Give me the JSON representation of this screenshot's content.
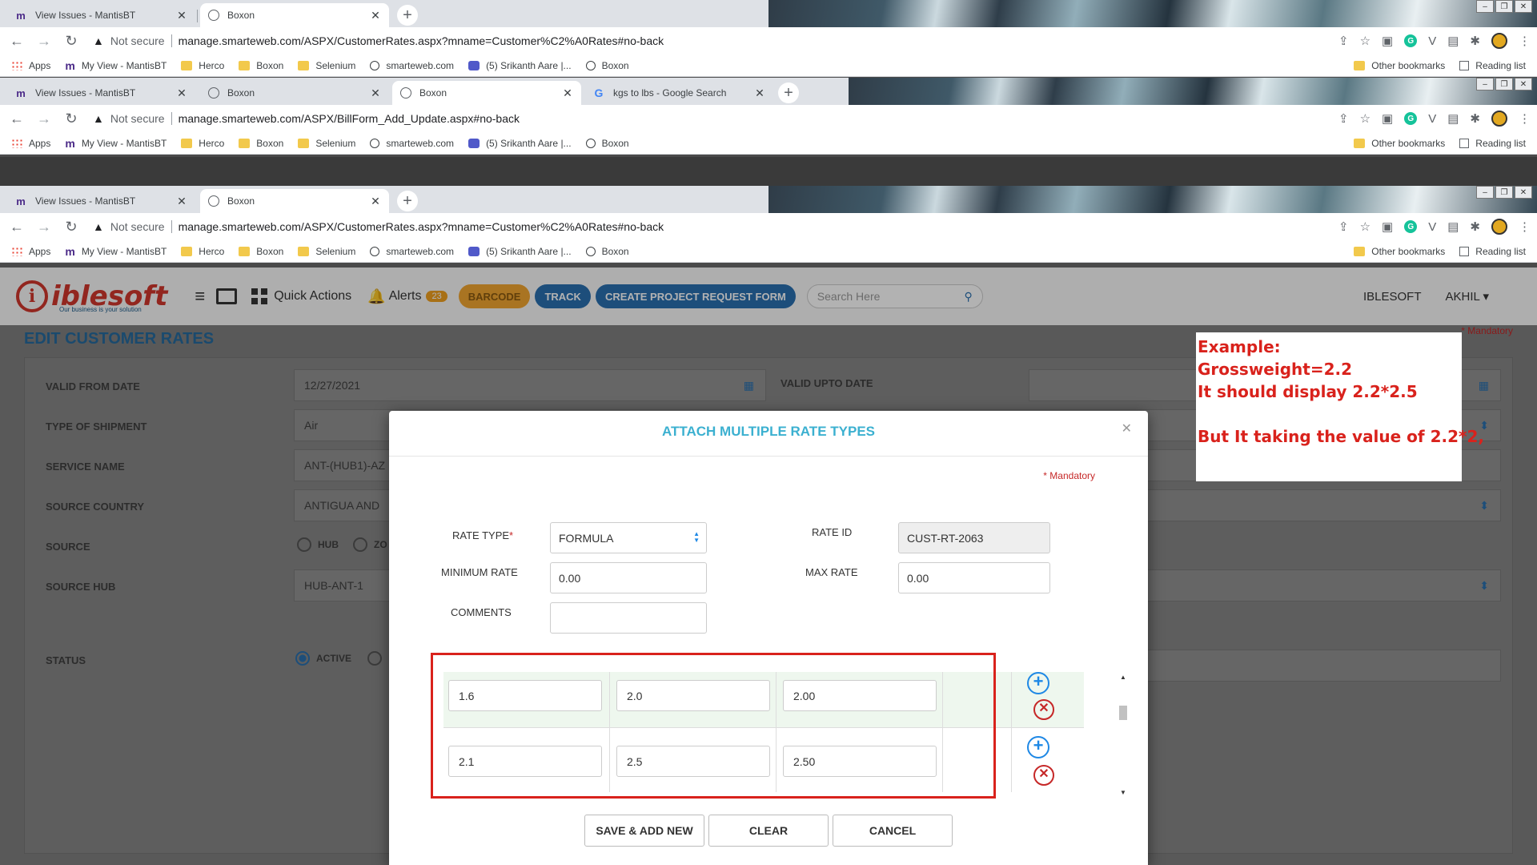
{
  "browser1": {
    "tabs": [
      {
        "title": "View Issues - MantisBT",
        "favicon": "m"
      },
      {
        "title": "Boxon",
        "favicon": "globe"
      }
    ],
    "url": "manage.smarteweb.com/ASPX/CustomerRates.aspx?mname=Customer%C2%A0Rates#no-back"
  },
  "browser2": {
    "tabs": [
      {
        "title": "View Issues - MantisBT",
        "favicon": "m"
      },
      {
        "title": "Boxon",
        "favicon": "globe"
      },
      {
        "title": "Boxon",
        "favicon": "globe"
      },
      {
        "title": "kgs to lbs - Google Search",
        "favicon": "g"
      }
    ],
    "url": "manage.smarteweb.com/ASPX/BillForm_Add_Update.aspx#no-back"
  },
  "browser3": {
    "tabs": [
      {
        "title": "View Issues - MantisBT",
        "favicon": "m"
      },
      {
        "title": "Boxon",
        "favicon": "globe"
      }
    ],
    "url": "manage.smarteweb.com/ASPX/CustomerRates.aspx?mname=Customer%C2%A0Rates#no-back"
  },
  "common": {
    "not_secure": "Not secure",
    "bookmarks": [
      "Apps",
      "My View - MantisBT",
      "Herco",
      "Boxon",
      "Selenium",
      "smarteweb.com",
      "(5) Srikanth Aare |...",
      "Boxon"
    ],
    "other_bookmarks": "Other bookmarks",
    "reading_list": "Reading list"
  },
  "app": {
    "logo_word": "iblesoft",
    "logo_tag": "Our business is your solution",
    "quick_actions": "Quick Actions",
    "alerts_label": "Alerts",
    "alerts_count": "23",
    "barcode": "BARCODE",
    "track": "TRACK",
    "create_project": "CREATE PROJECT REQUEST FORM",
    "search_placeholder": "Search Here",
    "company": "IBLESOFT",
    "user": "AKHIL"
  },
  "page": {
    "title": "EDIT CUSTOMER RATES",
    "mandatory": "* Mandatory",
    "valid_from_label": "VALID FROM DATE",
    "valid_from_value": "12/27/2021",
    "valid_upto_label": "VALID UPTO DATE",
    "type_label": "TYPE OF SHIPMENT",
    "type_value": "Air",
    "service_label": "SERVICE NAME",
    "service_value": "ANT-(HUB1)-AZ",
    "source_country_label": "SOURCE COUNTRY",
    "source_country_value": "ANTIGUA AND",
    "source_label": "SOURCE",
    "source_hub_opt": "HUB",
    "source_zone_opt": "ZO",
    "source_hub_label": "SOURCE HUB",
    "source_hub_value": "HUB-ANT-1",
    "status_label": "STATUS",
    "status_active": "ACTIVE"
  },
  "modal": {
    "title": "ATTACH MULTIPLE RATE TYPES",
    "mandatory": "* Mandatory",
    "rate_type_label": "RATE TYPE",
    "rate_type_value": "FORMULA",
    "rate_id_label": "RATE ID",
    "rate_id_value": "CUST-RT-2063",
    "min_rate_label": "MINIMUM RATE",
    "min_rate_value": "0.00",
    "max_rate_label": "MAX RATE",
    "max_rate_value": "0.00",
    "comments_label": "COMMENTS",
    "comments_value": "",
    "rows": [
      {
        "from": "1.6",
        "to": "2.0",
        "rate": "2.00"
      },
      {
        "from": "2.1",
        "to": "2.5",
        "rate": "2.50"
      }
    ],
    "save_add_new": "SAVE & ADD NEW",
    "clear": "CLEAR",
    "cancel": "CANCEL"
  },
  "annotation": {
    "lines": [
      "Example:",
      "Grossweight=2.2",
      "It should display  2.2*2.5",
      "",
      "But It taking  the value of 2.2*2,"
    ],
    "color": "#d9221c"
  }
}
